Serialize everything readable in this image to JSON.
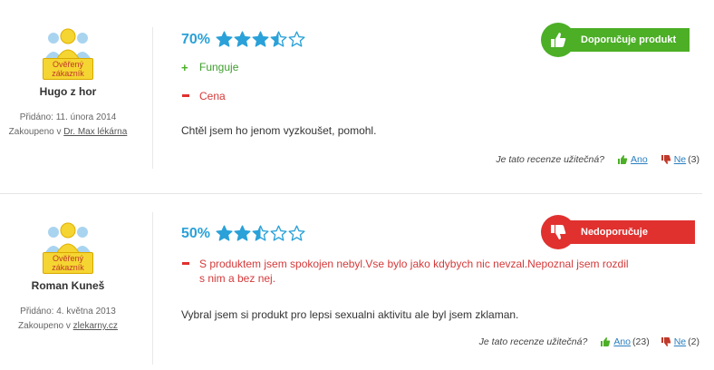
{
  "reviews": [
    {
      "badge": "Ověřený zákazník",
      "author": "Hugo z hor",
      "added_label": "Přidáno:",
      "added_date": "11. února 2014",
      "bought_label": "Zakoupeno v",
      "store": "Dr. Max lékárna",
      "percent": "70%",
      "rating_fraction": 0.7,
      "verdict": "Doporučuje produkt",
      "verdict_type": "positive",
      "pro": "Funguje",
      "con": "Cena",
      "text": "Chtěl jsem ho jenom vyzkoušet, pomohl.",
      "helpful_question": "Je tato recenze užitečná?",
      "yes_label": "Ano",
      "yes_count": "",
      "no_label": "Ne",
      "no_count": "(3)"
    },
    {
      "badge": "Ověřený zákazník",
      "author": "Roman Kuneš",
      "added_label": "Přidáno:",
      "added_date": "4. května 2013",
      "bought_label": "Zakoupeno v",
      "store": "zlekarny.cz",
      "percent": "50%",
      "rating_fraction": 0.5,
      "verdict": "Nedoporučuje produkt",
      "verdict_type": "negative",
      "con_line1": "S produktem jsem spokojen nebyl.Vse bylo jako kdybych nic nevzal.Nepoznal jsem rozdil",
      "con_line2": "s nim a bez nej.",
      "text": "Vybral jsem si produkt pro lepsi sexualni aktivitu ale byl jsem zklaman.",
      "helpful_question": "Je tato recenze užitečná?",
      "yes_label": "Ano",
      "yes_count": "(23)",
      "no_label": "Ne",
      "no_count": "(2)"
    }
  ],
  "colors": {
    "accent": "#2aa1d8",
    "positive": "#4caf26",
    "negative": "#e0312f",
    "badge": "#f5d531"
  }
}
